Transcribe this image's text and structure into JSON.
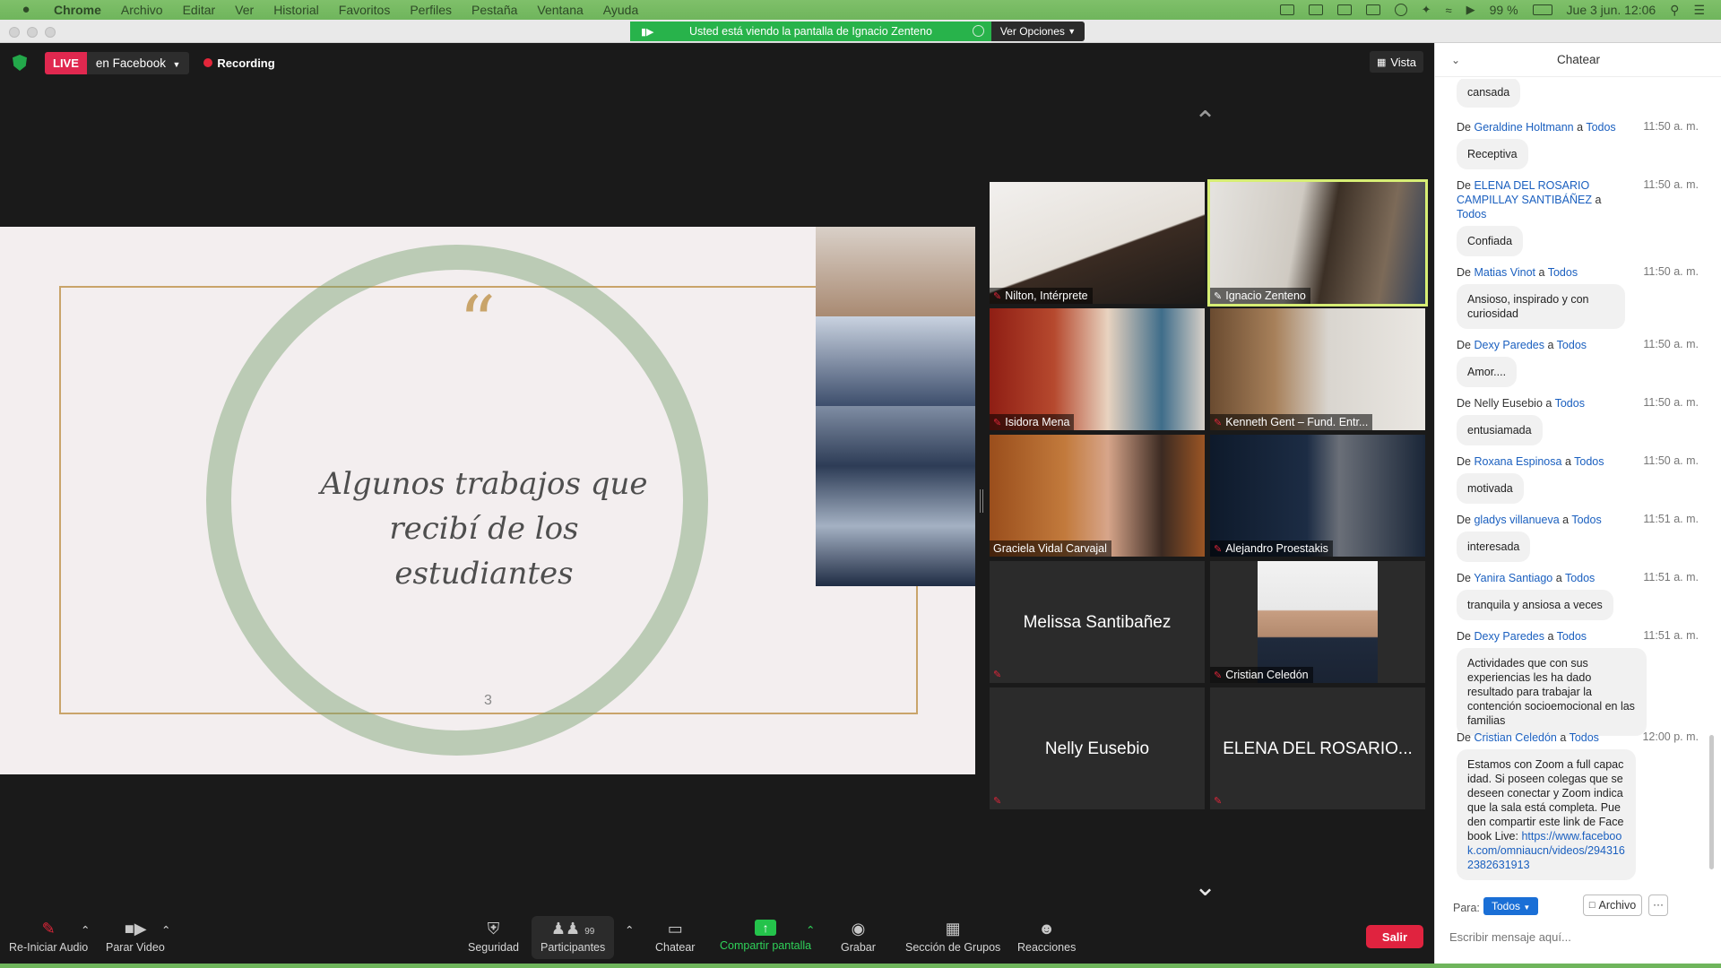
{
  "menubar": {
    "items": [
      "Chrome",
      "Archivo",
      "Editar",
      "Ver",
      "Historial",
      "Favoritos",
      "Perfiles",
      "Pestaña",
      "Ventana",
      "Ayuda"
    ],
    "battery": "99 %",
    "datetime": "Jue 3 jun.  12:06"
  },
  "banner": {
    "text": "Usted está viendo la pantalla de Ignacio Zenteno",
    "view_options": "Ver Opciones"
  },
  "topbar": {
    "live": "LIVE",
    "platform": "en Facebook",
    "recording": "Recording",
    "view": "Vista"
  },
  "slide": {
    "title_line1": "Algunos trabajos que",
    "title_line2": "recibí de los estudiantes",
    "page": "3"
  },
  "gallery": [
    {
      "name": "Nilton, Intérprete",
      "type": "video"
    },
    {
      "name": "Ignacio Zenteno",
      "type": "video",
      "active": true
    },
    {
      "name": "Isidora Mena",
      "type": "video"
    },
    {
      "name": "Kenneth Gent – Fund. Entr...",
      "type": "video"
    },
    {
      "name": "Graciela Vidal Carvajal",
      "type": "video"
    },
    {
      "name": "Alejandro Proestakis",
      "type": "video"
    },
    {
      "name": "Melissa Santibañez",
      "type": "name"
    },
    {
      "name": "Cristian Celedón",
      "type": "video"
    },
    {
      "name": "Nelly Eusebio",
      "type": "name"
    },
    {
      "name": "ELENA DEL ROSARIO...",
      "type": "name"
    }
  ],
  "toolbar": {
    "audio": "Re-Iniciar Audio",
    "video": "Parar Video",
    "security": "Seguridad",
    "participants": "Participantes",
    "participants_count": "99",
    "chat": "Chatear",
    "share": "Compartir pantalla",
    "record": "Grabar",
    "breakout": "Sección de Grupos",
    "reactions": "Reacciones",
    "leave": "Salir"
  },
  "chat": {
    "title": "Chatear",
    "messages": [
      {
        "from": "",
        "to": "",
        "time": "",
        "text": "cansada"
      },
      {
        "from": "Geraldine Holtmann",
        "to": "Todos",
        "time": "11:50 a. m.",
        "text": "Receptiva"
      },
      {
        "from": "ELENA DEL ROSARIO CAMPILLAY SANTIBÁÑEZ",
        "to": "Todos",
        "time": "11:50 a. m.",
        "text": "Confiada"
      },
      {
        "from": "Matias Vinot",
        "to": "Todos",
        "time": "11:50 a. m.",
        "text": "Ansioso, inspirado y con curiosidad"
      },
      {
        "from": "Dexy Paredes",
        "to": "Todos",
        "time": "11:50 a. m.",
        "text": "Amor...."
      },
      {
        "from": "Nelly Eusebio",
        "to": "Todos",
        "time": "11:50 a. m.",
        "text": "entusiamada"
      },
      {
        "from": "Roxana Espinosa",
        "to": "Todos",
        "time": "11:50 a. m.",
        "text": "motivada"
      },
      {
        "from": "gladys villanueva",
        "to": "Todos",
        "time": "11:51 a. m.",
        "text": "interesada"
      },
      {
        "from": "Yanira Santiago",
        "to": "Todos",
        "time": "11:51 a. m.",
        "text": "tranquila y ansiosa a veces"
      },
      {
        "from": "Dexy Paredes",
        "to": "Todos",
        "time": "11:51 a. m.",
        "text": "Actividades que con sus experiencias les ha dado resultado para trabajar la contención socioemocional en las familias"
      },
      {
        "from": "Cristian Celedón",
        "to": "Todos",
        "time": "12:00 p. m.",
        "text": "Estamos con Zoom a full capacidad. Si poseen colegas que se deseen conectar y Zoom indica que la sala está completa. Pueden compartir este link de Facebook Live: ",
        "link": "https://www.facebook.com/omniaucn/videos/2943162382631913"
      }
    ],
    "de": "De",
    "a": "a",
    "to_label": "Para:",
    "to_value": "Todos",
    "file_button": "Archivo",
    "input_placeholder": "Escribir mensaje aquí..."
  }
}
